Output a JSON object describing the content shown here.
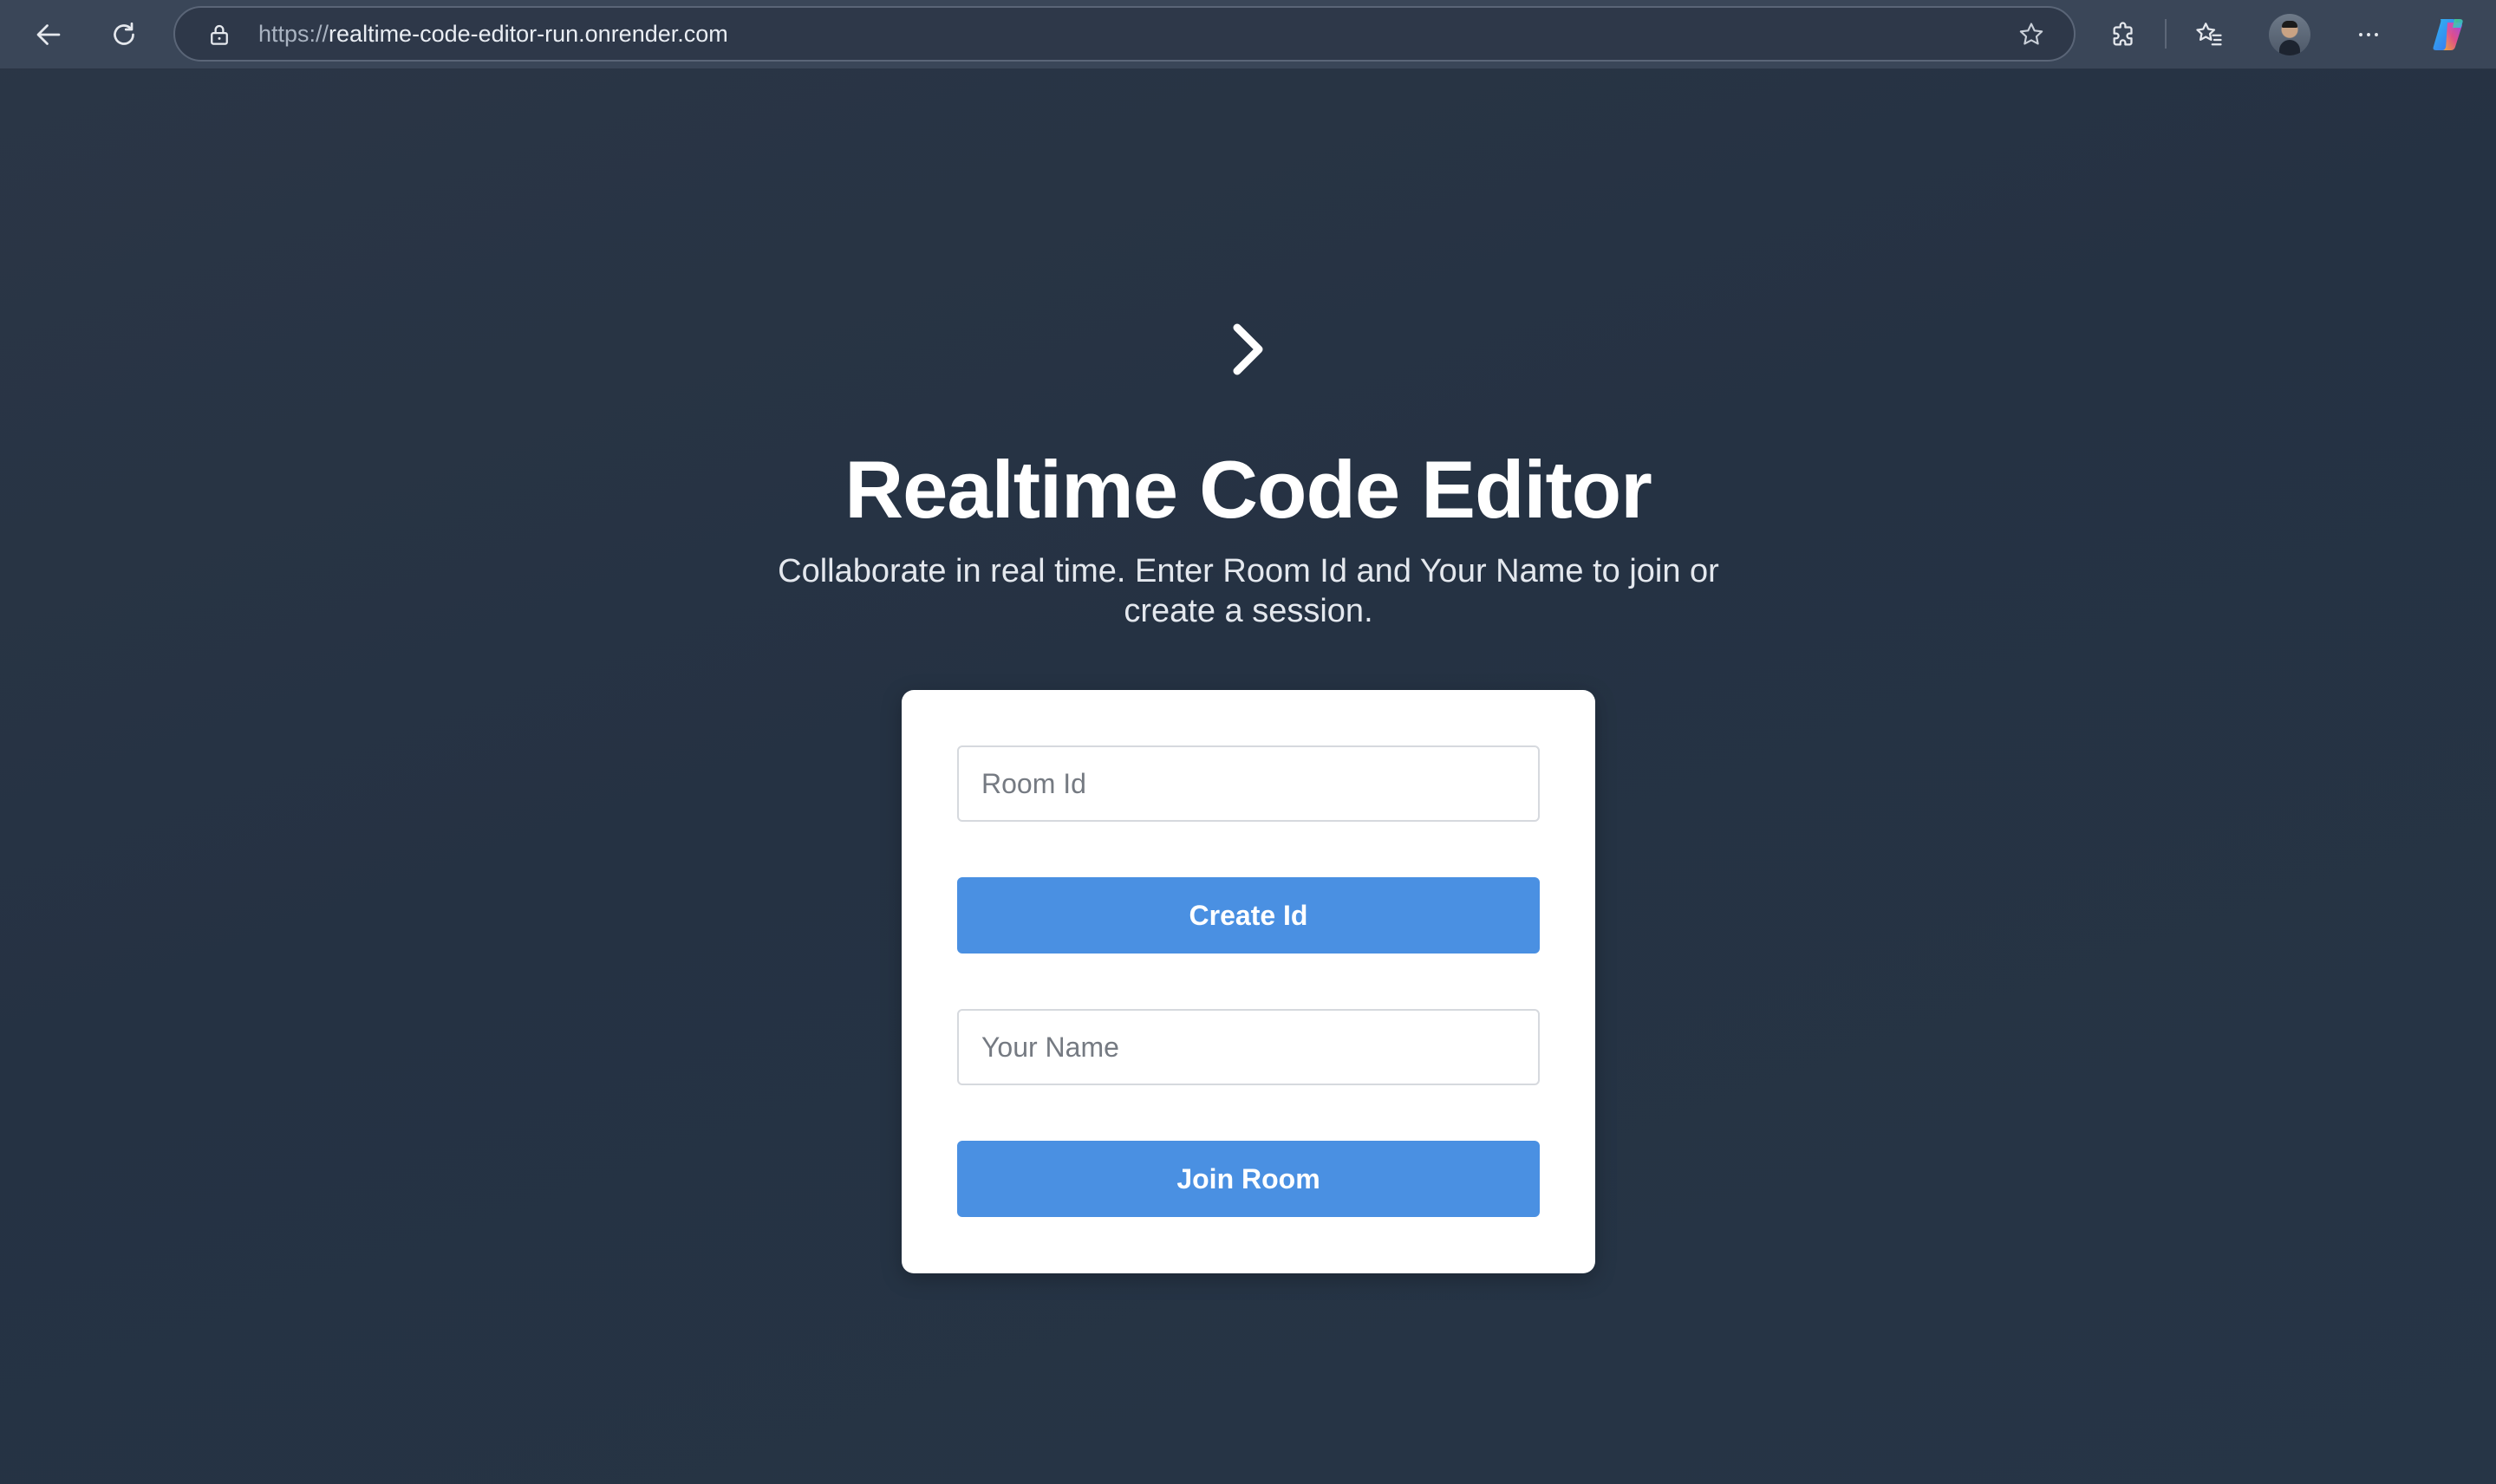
{
  "browser": {
    "url_scheme": "https://",
    "url_host": "realtime-code-editor-run.onrender.com",
    "icons": {
      "back": "arrow-left-icon",
      "reload": "reload-icon",
      "lock": "lock-icon",
      "favorite": "star-icon",
      "extensions": "puzzle-icon",
      "favorites_list": "favorites-icon",
      "profile": "avatar",
      "more": "ellipsis-icon",
      "copilot": "copilot-icon"
    }
  },
  "page": {
    "logo_icon": "chevron-right-icon",
    "title": "Realtime Code Editor",
    "subtitle": "Collaborate in real time. Enter Room Id and Your Name to join or create a session."
  },
  "form": {
    "room_id": {
      "placeholder": "Room Id",
      "value": ""
    },
    "create_label": "Create Id",
    "name": {
      "placeholder": "Your Name",
      "value": ""
    },
    "join_label": "Join Room"
  },
  "colors": {
    "background": "#253243",
    "browser_bar": "#3a4658",
    "card": "#ffffff",
    "accent": "#4a90e2",
    "title_text": "#ffffff"
  }
}
